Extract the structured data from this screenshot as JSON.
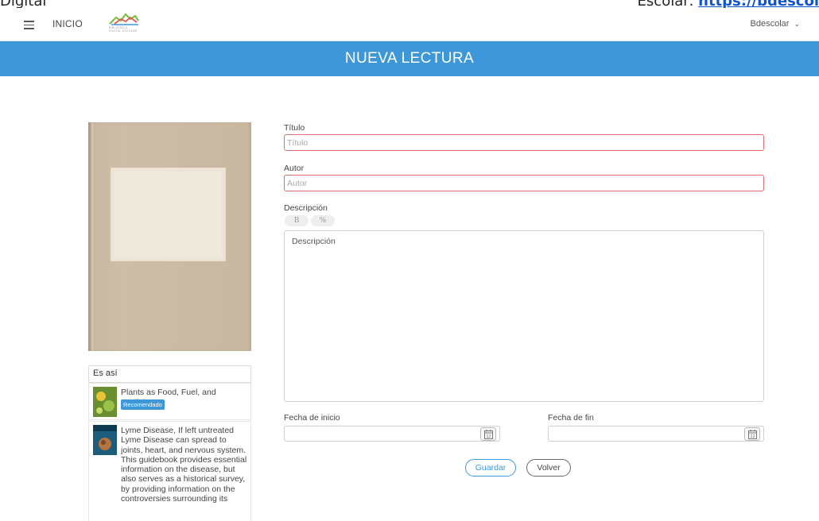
{
  "doc": {
    "left_fragment": "Digital",
    "right_prefix": "Escolar:",
    "right_link": "https://bdescol"
  },
  "navbar": {
    "home_label": "INICIO",
    "logo_text": "BIBLIOTECA DIGITAL ESCOLAR",
    "user_label": "Bdescolar"
  },
  "page": {
    "title": "NUEVA LECTURA"
  },
  "sidebar": {
    "collection_label": "Es así",
    "items": [
      {
        "title": "Plants as Food, Fuel, and Medicine",
        "badge": "Recomendado"
      },
      {
        "description": "Lyme Disease, If left untreated Lyme Disease can spread to joints, heart, and nervous system. This guidebook provides essential information on the disease, but also serves as a historical survey, by providing information on the controversies surrounding its"
      }
    ]
  },
  "form": {
    "title_label": "Título",
    "title_placeholder": "Título",
    "author_label": "Autor",
    "author_placeholder": "Autor",
    "description_label": "Descripción",
    "description_placeholder": "Descripción",
    "toolbar": {
      "bold_label": "B",
      "link_label": "%"
    },
    "start_date_label": "Fecha de inicio",
    "end_date_label": "Fecha de fin",
    "calendar_day": "12",
    "save_label": "Guardar",
    "back_label": "Volver"
  },
  "colors": {
    "accent": "#3e97d8",
    "error_border": "#e06a72"
  }
}
